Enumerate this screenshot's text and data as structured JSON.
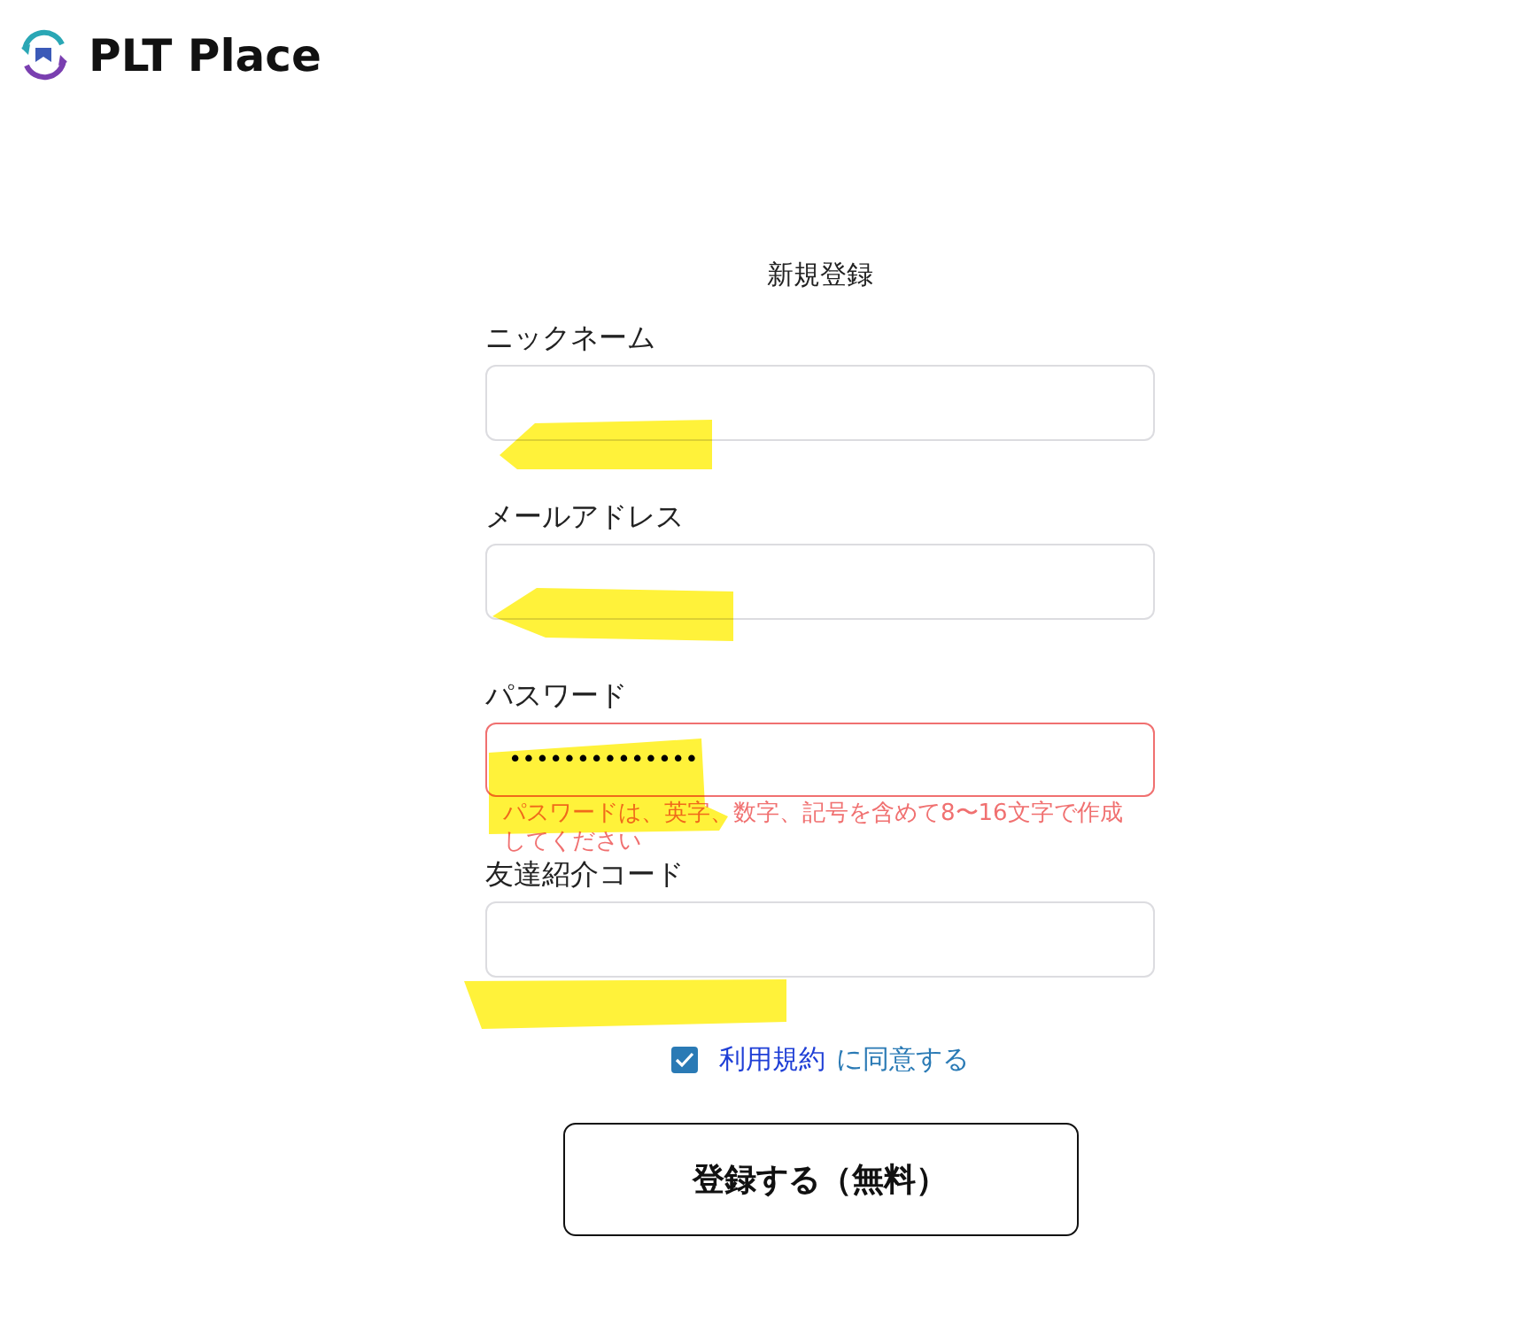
{
  "logo": {
    "text": "PLT Place"
  },
  "form": {
    "title": "新規登録",
    "fields": [
      {
        "label": "ニックネーム",
        "error": false,
        "highlighted": true
      },
      {
        "label": "メールアドレス",
        "error": false,
        "highlighted": true
      },
      {
        "label": "パスワード",
        "value": "••••••••••••••",
        "error": true,
        "error_message": "パスワードは、英字、数字、記号を含めて8〜16文字で作成してください",
        "highlighted": true
      },
      {
        "label": "友達紹介コード",
        "error": false,
        "highlighted": true
      }
    ],
    "terms": {
      "checked": true,
      "link": "利用規約",
      "text": "に同意する"
    },
    "submit": "登録する（無料）"
  }
}
